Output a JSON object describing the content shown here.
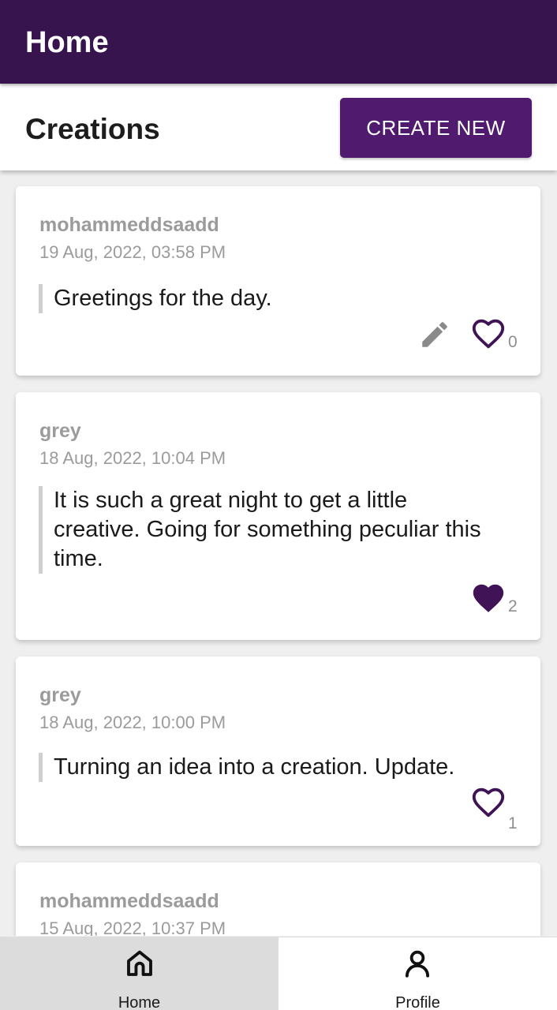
{
  "appbar": {
    "title": "Home"
  },
  "section": {
    "title": "Creations",
    "create_label": "CREATE NEW"
  },
  "posts": [
    {
      "author": "mohammeddsaadd",
      "date": "19 Aug, 2022, 03:58 PM",
      "text": "Greetings for the day.",
      "likes": "0",
      "liked": false,
      "editable": true
    },
    {
      "author": "grey",
      "date": "18 Aug, 2022, 10:04 PM",
      "text": "It is such a great night to get a little creative. Going for something peculiar this time.",
      "likes": "2",
      "liked": true,
      "editable": false
    },
    {
      "author": "grey",
      "date": "18 Aug, 2022, 10:00 PM",
      "text": "Turning an idea into a creation. Update.",
      "likes": "1",
      "liked": false,
      "editable": false
    },
    {
      "author": "mohammeddsaadd",
      "date": "15 Aug, 2022, 10:37 PM"
    }
  ],
  "nav": {
    "home_label": "Home",
    "profile_label": "Profile",
    "home_icon": "home-icon",
    "profile_icon": "person-icon"
  },
  "colors": {
    "primary": "#38144f",
    "button": "#501a6e",
    "like": "#3f1356",
    "muted_text": "#9b9b9b"
  }
}
